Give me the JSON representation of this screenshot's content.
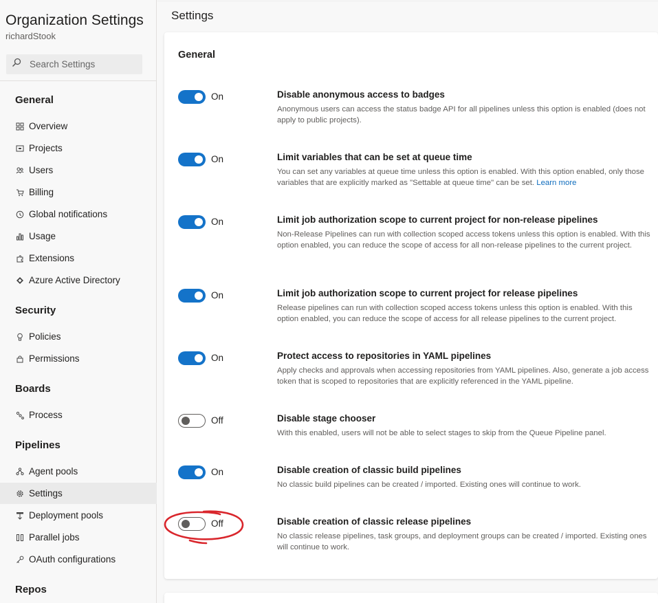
{
  "sidebar": {
    "org_title": "Organization Settings",
    "user": "richardStook",
    "search_placeholder": "Search Settings",
    "sections": {
      "general": "General",
      "security": "Security",
      "boards": "Boards",
      "pipelines": "Pipelines",
      "repos": "Repos"
    },
    "items": {
      "overview": "Overview",
      "projects": "Projects",
      "users": "Users",
      "billing": "Billing",
      "global_notifications": "Global notifications",
      "usage": "Usage",
      "extensions": "Extensions",
      "azure_ad": "Azure Active Directory",
      "policies": "Policies",
      "permissions": "Permissions",
      "process": "Process",
      "agent_pools": "Agent pools",
      "settings": "Settings",
      "deployment_pools": "Deployment pools",
      "parallel_jobs": "Parallel jobs",
      "oauth": "OAuth configurations"
    }
  },
  "main": {
    "page_title": "Settings",
    "card_title": "General",
    "learn_more": "Learn more",
    "settings": [
      {
        "state": "On",
        "title": "Disable anonymous access to badges",
        "desc": "Anonymous users can access the status badge API for all pipelines unless this option is enabled (does not apply to public projects)."
      },
      {
        "state": "On",
        "title": "Limit variables that can be set at queue time",
        "desc": "You can set any variables at queue time unless this option is enabled. With this option enabled, only those variables that are explicitly marked as \"Settable at queue time\" can be set."
      },
      {
        "state": "On",
        "title": "Limit job authorization scope to current project for non-release pipelines",
        "desc": "Non-Release Pipelines can run with collection scoped access tokens unless this option is enabled. With this option enabled, you can reduce the scope of access for all non-release pipelines to the current project."
      },
      {
        "state": "On",
        "title": "Limit job authorization scope to current project for release pipelines",
        "desc": "Release pipelines can run with collection scoped access tokens unless this option is enabled. With this option enabled, you can reduce the scope of access for all release pipelines to the current project."
      },
      {
        "state": "On",
        "title": "Protect access to repositories in YAML pipelines",
        "desc": "Apply checks and approvals when accessing repositories from YAML pipelines. Also, generate a job access token that is scoped to repositories that are explicitly referenced in the YAML pipeline."
      },
      {
        "state": "Off",
        "title": "Disable stage chooser",
        "desc": "With this enabled, users will not be able to select stages to skip from the Queue Pipeline panel."
      },
      {
        "state": "On",
        "title": "Disable creation of classic build pipelines",
        "desc": "No classic build pipelines can be created / imported. Existing ones will continue to work."
      },
      {
        "state": "Off",
        "title": "Disable creation of classic release pipelines",
        "desc": "No classic release pipelines, task groups, and deployment groups can be created / imported. Existing ones will continue to work."
      }
    ]
  },
  "colors": {
    "accent": "#1473c9",
    "annotation": "#d9262c"
  }
}
